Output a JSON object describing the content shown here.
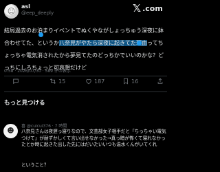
{
  "author": {
    "name": "asl",
    "handle": "@eep_deeply",
    "avatar_glyph": "☺"
  },
  "brand": {
    "x": "𝕏",
    "suffix": ".com"
  },
  "post": {
    "text_before": "結局過去のお泊まりイベントでぬくやながしょっちゅう深夜に鉢合わせてた、というか",
    "text_highlight": "八奈見がやたら深夜に起きてた理由",
    "text_after": "ってちょっちゃ電気消されたから夢見てたのどっちかでいいのかな？どっちにしろちょっと可哀想だけど",
    "meta": "0:58 · 2026/07/30 · 589 件の表示"
  },
  "actions": {
    "reply_count": "",
    "repost_count": "15",
    "like_count": "187",
    "bookmark_count": "16"
  },
  "more_section": {
    "title": "もっと見つける"
  },
  "reply": {
    "header": "喜 @cuicui376 · 7 時間",
    "text": "八奈見さんは夜遅っ寝りなので、文芸部女子相手だと「ちっちゃい電気つけて」が耐ずかしくて言い出せなかった→真っ暗が怖くて寝れなかったとか時に起きた出した先にはだいたいいつも温水くんがいてくれ",
    "tail": "ということ？",
    "avatar_glyph": "☻"
  },
  "colors": {
    "background": "#000000",
    "text": "#e7e9ea",
    "muted": "#71767b",
    "accent": "#1d9bf0",
    "divider": "#2f3336"
  }
}
